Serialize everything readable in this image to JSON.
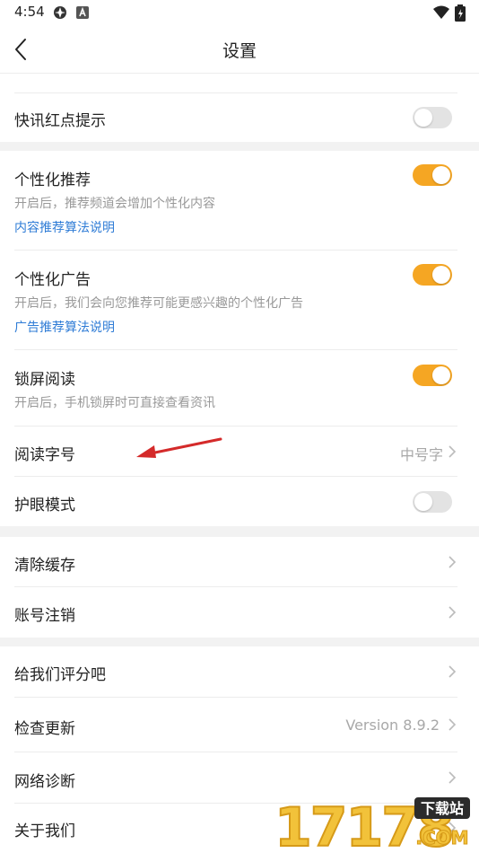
{
  "status_bar": {
    "time": "4:54"
  },
  "header": {
    "title": "设置"
  },
  "settings": {
    "quick_news_dot": {
      "label": "快讯红点提示",
      "enabled": false
    },
    "personalized_recommend": {
      "label": "个性化推荐",
      "desc": "开启后，推荐频道会增加个性化内容",
      "link": "内容推荐算法说明",
      "enabled": true
    },
    "personalized_ads": {
      "label": "个性化广告",
      "desc": "开启后，我们会向您推荐可能更感兴趣的个性化广告",
      "link": "广告推荐算法说明",
      "enabled": true
    },
    "lockscreen_reading": {
      "label": "锁屏阅读",
      "desc": "开启后，手机锁屏时可直接查看资讯",
      "enabled": true
    },
    "font_size": {
      "label": "阅读字号",
      "value": "中号字"
    },
    "eye_care": {
      "label": "护眼模式",
      "enabled": false
    },
    "clear_cache": {
      "label": "清除缓存"
    },
    "account_cancel": {
      "label": "账号注销"
    },
    "rate_us": {
      "label": "给我们评分吧"
    },
    "check_update": {
      "label": "检查更新",
      "value": "Version 8.9.2"
    },
    "network_diagnose": {
      "label": "网络诊断"
    },
    "about_us": {
      "label": "关于我们"
    }
  },
  "watermark": {
    "number": "17178",
    "badge": "下载站",
    "domain": ".COM"
  },
  "colors": {
    "toggle_on": "#f5a623",
    "toggle_off": "#e3e3e3",
    "link": "#2f7cd6",
    "annotation_arrow": "#d42a2a"
  },
  "icons": {
    "status": [
      "gear-icon",
      "a-box-icon",
      "wifi-icon",
      "battery-icon"
    ],
    "nav": "back-arrow-icon",
    "row": "chevron-right-icon"
  }
}
